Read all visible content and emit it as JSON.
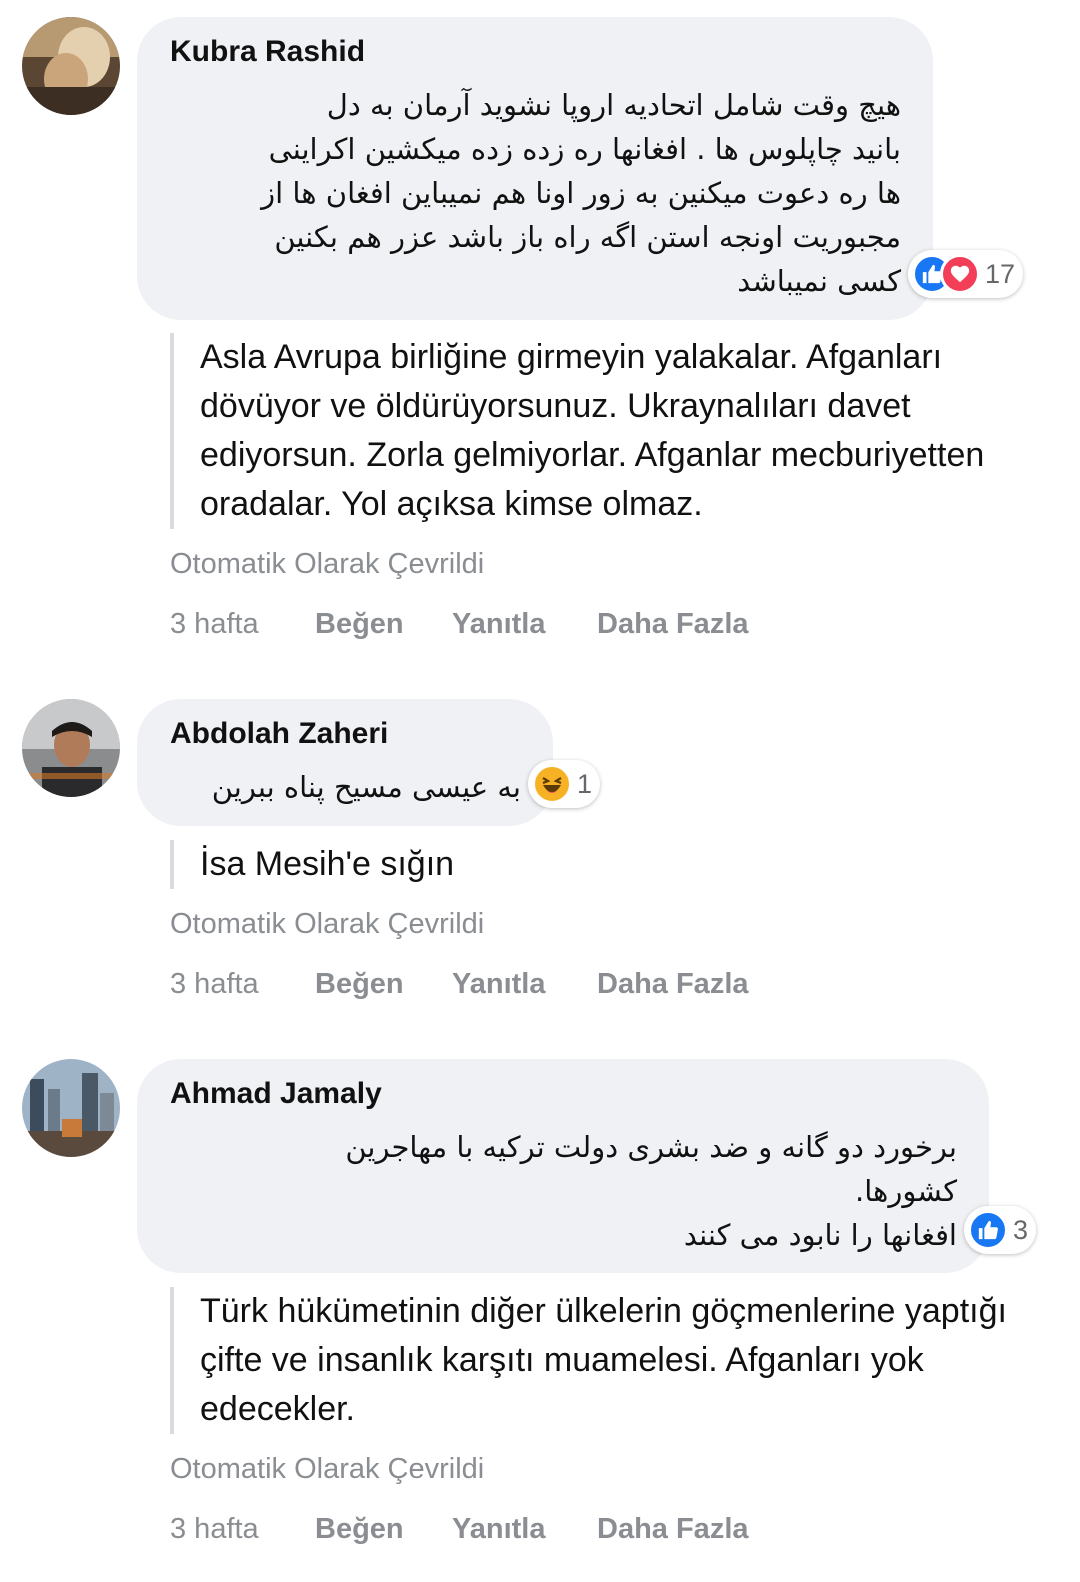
{
  "comments": [
    {
      "author": "Kubra Rashid",
      "original_text": "هیچ وقت شامل اتحادیه اروپا نشوید آرمان به دل\nبانید چاپلوس ها . افغانها ره زده زده میکشین اکراینی\nها ره دعوت میکنین به زور اونا هم نمیباین افغان ها از\nمجبوریت اونجه استن اگه راه باز باشد عزر هم بکنین\nکسی نمیباشد",
      "reactions": [
        "like",
        "love"
      ],
      "reaction_count": "17",
      "translation": "Asla Avrupa birliğine girmeyin yalakalar. Afganları dövüyor ve öldürüyorsunuz. Ukraynalıları davet ediyorsun. Zorla gelmiyorlar. Afganlar mecburiyetten oradalar. Yol açıksa kimse olmaz.",
      "auto_label": "Otomatik Olarak Çevrildi",
      "time": "3 hafta",
      "like_label": "Beğen",
      "reply_label": "Yanıtla",
      "more_label": "Daha Fazla"
    },
    {
      "author": "Abdolah Zaheri",
      "original_text": "به عیسی مسیح پناه ببرین",
      "reactions": [
        "haha"
      ],
      "reaction_count": "1",
      "translation": "İsa Mesih'e sığın",
      "auto_label": "Otomatik Olarak Çevrildi",
      "time": "3 hafta",
      "like_label": "Beğen",
      "reply_label": "Yanıtla",
      "more_label": "Daha Fazla"
    },
    {
      "author": "Ahmad Jamaly",
      "original_text": "برخورد دو گانه و ضد بشری دولت ترکیه با مهاجرین\nکشورها.\nافغانها را نابود می کنند",
      "reactions": [
        "like"
      ],
      "reaction_count": "3",
      "translation": "Türk hükümetinin diğer ülkelerin göçmenlerine yaptığı çifte ve insanlık karşıtı muamelesi. Afganları yok edecekler.",
      "auto_label": "Otomatik Olarak Çevrildi",
      "time": "3 hafta",
      "like_label": "Beğen",
      "reply_label": "Yanıtla",
      "more_label": "Daha Fazla"
    }
  ],
  "colors": {
    "bubble": "#eff1f4",
    "meta": "#8a8d91",
    "like": "#1877f2",
    "love": "#f33e58",
    "haha": "#f7b125"
  }
}
